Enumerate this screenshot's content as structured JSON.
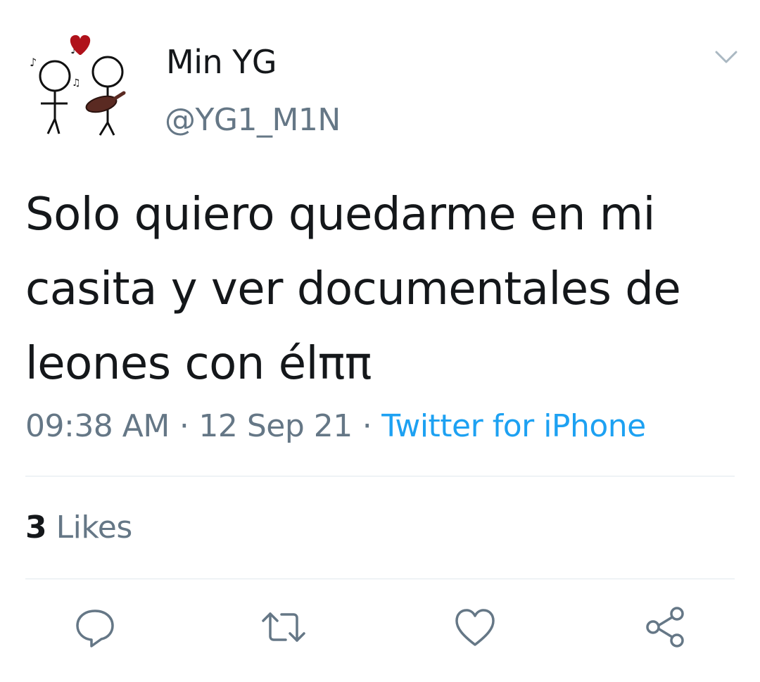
{
  "tweet": {
    "author": {
      "display_name": "Min YG",
      "handle": "@YG1_M1N",
      "avatar_icon": "stick-figures-heart-icon"
    },
    "text_lines": [
      "Solo quiero quedarme en mi",
      "casita y ver documentales de",
      "leones con élππ"
    ],
    "time": "09:38 AM",
    "separator": "·",
    "date": "12 Sep 21",
    "source": "Twitter for iPhone",
    "likes_count": "3",
    "likes_label": "Likes"
  },
  "actions": [
    {
      "name": "reply",
      "icon": "speech-bubble-icon"
    },
    {
      "name": "retweet",
      "icon": "retweet-arrows-icon"
    },
    {
      "name": "like",
      "icon": "heart-outline-icon"
    },
    {
      "name": "share",
      "icon": "share-nodes-icon"
    }
  ],
  "colors": {
    "text": "#14171a",
    "secondary": "#657786",
    "link": "#1da1f2",
    "divider": "#e1e8ed",
    "heart": "#b0121b"
  }
}
